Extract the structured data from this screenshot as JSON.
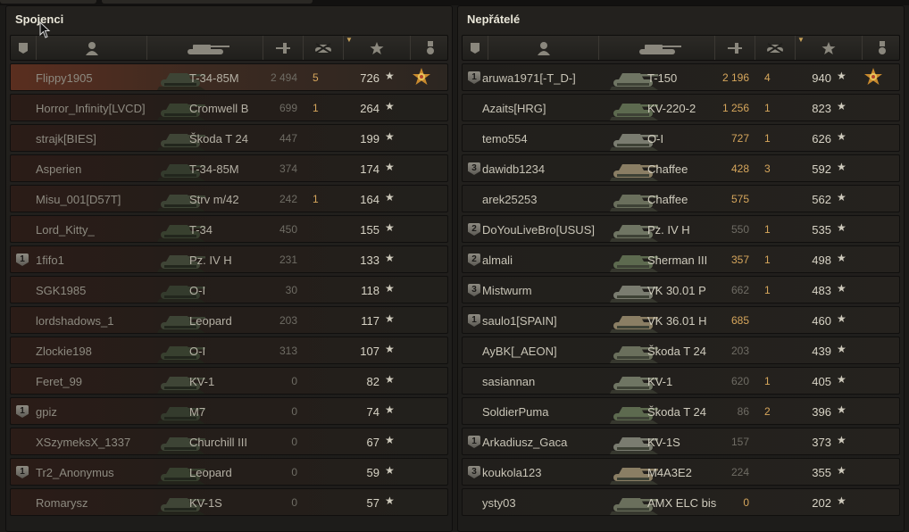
{
  "allies": {
    "title": "Spojenci",
    "rows": [
      {
        "name": "Flippy1905",
        "tank": "T-34-85M",
        "damage": "2 494",
        "kills": "5",
        "xp": "726",
        "platoon": "",
        "me": true,
        "medal": true,
        "dmg_hi": false
      },
      {
        "name": "Horror_Infinity[LVCD]",
        "tank": "Cromwell B",
        "damage": "699",
        "kills": "1",
        "xp": "264",
        "platoon": ""
      },
      {
        "name": "strajk[BIES]",
        "tank": "Škoda T 24",
        "damage": "447",
        "kills": "",
        "xp": "199",
        "platoon": ""
      },
      {
        "name": "Asperien",
        "tank": "T-34-85M",
        "damage": "374",
        "kills": "",
        "xp": "174",
        "platoon": ""
      },
      {
        "name": "Misu_001[D57T]",
        "tank": "Strv m/42",
        "damage": "242",
        "kills": "1",
        "xp": "164",
        "platoon": ""
      },
      {
        "name": "Lord_Kitty_",
        "tank": "T-34",
        "damage": "450",
        "kills": "",
        "xp": "155",
        "platoon": ""
      },
      {
        "name": "1fifo1",
        "tank": "Pz. IV H",
        "damage": "231",
        "kills": "",
        "xp": "133",
        "platoon": "1"
      },
      {
        "name": "SGK1985",
        "tank": "O-I",
        "damage": "30",
        "kills": "",
        "xp": "118",
        "platoon": ""
      },
      {
        "name": "lordshadows_1",
        "tank": "Leopard",
        "damage": "203",
        "kills": "",
        "xp": "117",
        "platoon": ""
      },
      {
        "name": "Zlockie198",
        "tank": "O-I",
        "damage": "313",
        "kills": "",
        "xp": "107",
        "platoon": ""
      },
      {
        "name": "Feret_99",
        "tank": "KV-1",
        "damage": "0",
        "kills": "",
        "xp": "82",
        "platoon": ""
      },
      {
        "name": "gpiz",
        "tank": "M7",
        "damage": "0",
        "kills": "",
        "xp": "74",
        "platoon": "1"
      },
      {
        "name": "XSzymeksX_1337",
        "tank": "Churchill III",
        "damage": "0",
        "kills": "",
        "xp": "67",
        "platoon": ""
      },
      {
        "name": "Tr2_Anonymus",
        "tank": "Leopard",
        "damage": "0",
        "kills": "",
        "xp": "59",
        "platoon": "1"
      },
      {
        "name": "Romarysz",
        "tank": "KV-1S",
        "damage": "0",
        "kills": "",
        "xp": "57",
        "platoon": ""
      }
    ]
  },
  "enemies": {
    "title": "Nepřátelé",
    "rows": [
      {
        "name": "aruwa1971[-T_D-]",
        "tank": "T-150",
        "damage": "2 196",
        "kills": "4",
        "xp": "940",
        "platoon": "1",
        "medal": true,
        "dmg_hi": true
      },
      {
        "name": "Azaits[HRG]",
        "tank": "KV-220-2",
        "damage": "1 256",
        "kills": "1",
        "xp": "823",
        "platoon": "",
        "dmg_hi": true
      },
      {
        "name": "temo554",
        "tank": "O-I",
        "damage": "727",
        "kills": "1",
        "xp": "626",
        "platoon": "",
        "dmg_hi": true
      },
      {
        "name": "dawidb1234",
        "tank": "Chaffee",
        "damage": "428",
        "kills": "3",
        "xp": "592",
        "platoon": "3",
        "dmg_hi": true
      },
      {
        "name": "arek25253",
        "tank": "Chaffee",
        "damage": "575",
        "kills": "",
        "xp": "562",
        "platoon": "",
        "dmg_hi": true
      },
      {
        "name": "DoYouLiveBro[USUS]",
        "tank": "Pz. IV H",
        "damage": "550",
        "kills": "1",
        "xp": "535",
        "platoon": "2"
      },
      {
        "name": "almali",
        "tank": "Sherman III",
        "damage": "357",
        "kills": "1",
        "xp": "498",
        "platoon": "2",
        "dmg_hi": true
      },
      {
        "name": "Mistwurm",
        "tank": "VK 30.01 P",
        "damage": "662",
        "kills": "1",
        "xp": "483",
        "platoon": "3"
      },
      {
        "name": "saulo1[SPAIN]",
        "tank": "VK 36.01 H",
        "damage": "685",
        "kills": "",
        "xp": "460",
        "platoon": "1",
        "dmg_hi": true
      },
      {
        "name": "AyBK[_AEON]",
        "tank": "Škoda T 24",
        "damage": "203",
        "kills": "",
        "xp": "439",
        "platoon": ""
      },
      {
        "name": "sasiannan",
        "tank": "KV-1",
        "damage": "620",
        "kills": "1",
        "xp": "405",
        "platoon": ""
      },
      {
        "name": "SoldierPuma",
        "tank": "Škoda T 24",
        "damage": "86",
        "kills": "2",
        "xp": "396",
        "platoon": ""
      },
      {
        "name": "Arkadiusz_Gaca",
        "tank": "KV-1S",
        "damage": "157",
        "kills": "",
        "xp": "373",
        "platoon": "1"
      },
      {
        "name": "koukola123",
        "tank": "M4A3E2",
        "damage": "224",
        "kills": "",
        "xp": "355",
        "platoon": "3"
      },
      {
        "name": "ysty03",
        "tank": "AMX ELC bis",
        "damage": "0",
        "kills": "",
        "xp": "202",
        "platoon": "",
        "dmg_hi": true
      }
    ]
  },
  "icons": {
    "header": [
      "platoon-icon",
      "player-icon",
      "tank-icon",
      "damage-icon",
      "kills-icon",
      "sort-arrow-icon",
      "xp-star-icon",
      "medal-icon"
    ],
    "star_glyph": "★"
  },
  "colors": {
    "highlight": "#d6a65c",
    "me_row": "#5a2e1f"
  }
}
